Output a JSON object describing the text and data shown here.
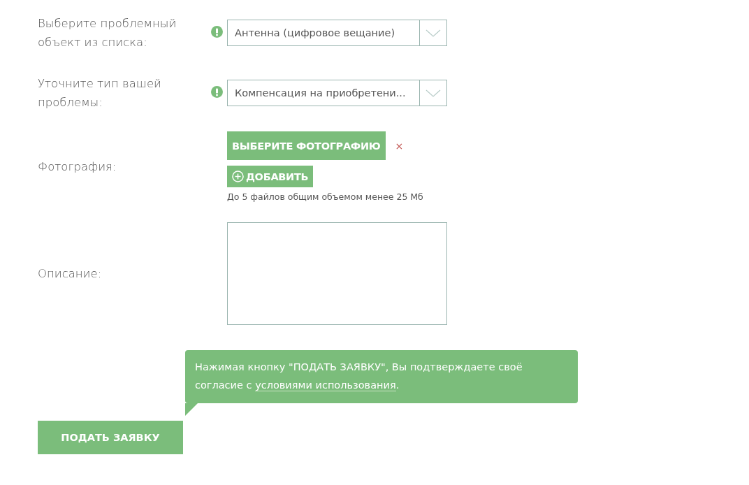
{
  "fields": [
    {
      "kind": "select",
      "label": "Выберите проблемный объект из списка:",
      "required": true,
      "value": "Антенна (цифровое вещание)"
    },
    {
      "kind": "select",
      "label": "Уточните тип вашей проблемы:",
      "required": true,
      "value": "Компенсация на приобретени..."
    },
    {
      "kind": "photo",
      "label": "Фотография:",
      "required": false,
      "choose_button": "ВЫБЕРИТЕ ФОТОГРАФИЮ",
      "remove": "×",
      "add_button": "ДОБАВИТЬ",
      "hint": "До 5 файлов общим объемом менее 25 Мб"
    },
    {
      "kind": "textarea",
      "label": "Описание:",
      "required": false
    }
  ],
  "notice": {
    "text": "Нажимая кнопку \"ПОДАТЬ ЗАЯВКУ\", Вы подтверждаете своё согласие с ",
    "link": "условиями использования",
    "after": "."
  },
  "submit_button": "ПОДАТЬ ЗАЯВКУ"
}
